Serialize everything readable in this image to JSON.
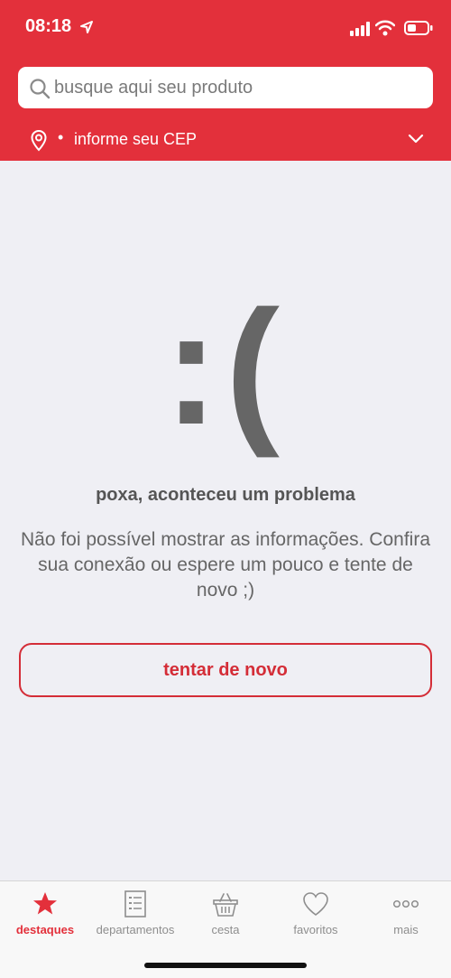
{
  "status_bar": {
    "time": "08:18"
  },
  "search": {
    "placeholder": "busque aqui seu produto"
  },
  "cep": {
    "bullet": "•",
    "label": "informe seu CEP"
  },
  "error": {
    "face": ":(",
    "title": "poxa, aconteceu um problema",
    "message": "Não foi possível mostrar as informações. Confira sua conexão ou espere um pouco e tente de novo ;)",
    "retry_label": "tentar de novo"
  },
  "tabbar": {
    "items": [
      {
        "label": "destaques",
        "icon": "star-icon",
        "active": true
      },
      {
        "label": "departamentos",
        "icon": "list-icon",
        "active": false
      },
      {
        "label": "cesta",
        "icon": "basket-icon",
        "active": false
      },
      {
        "label": "favoritos",
        "icon": "heart-icon",
        "active": false
      },
      {
        "label": "mais",
        "icon": "more-icon",
        "active": false
      }
    ]
  },
  "colors": {
    "brand": "#E3303B",
    "background": "#EFEFF4",
    "text": "#666666"
  }
}
